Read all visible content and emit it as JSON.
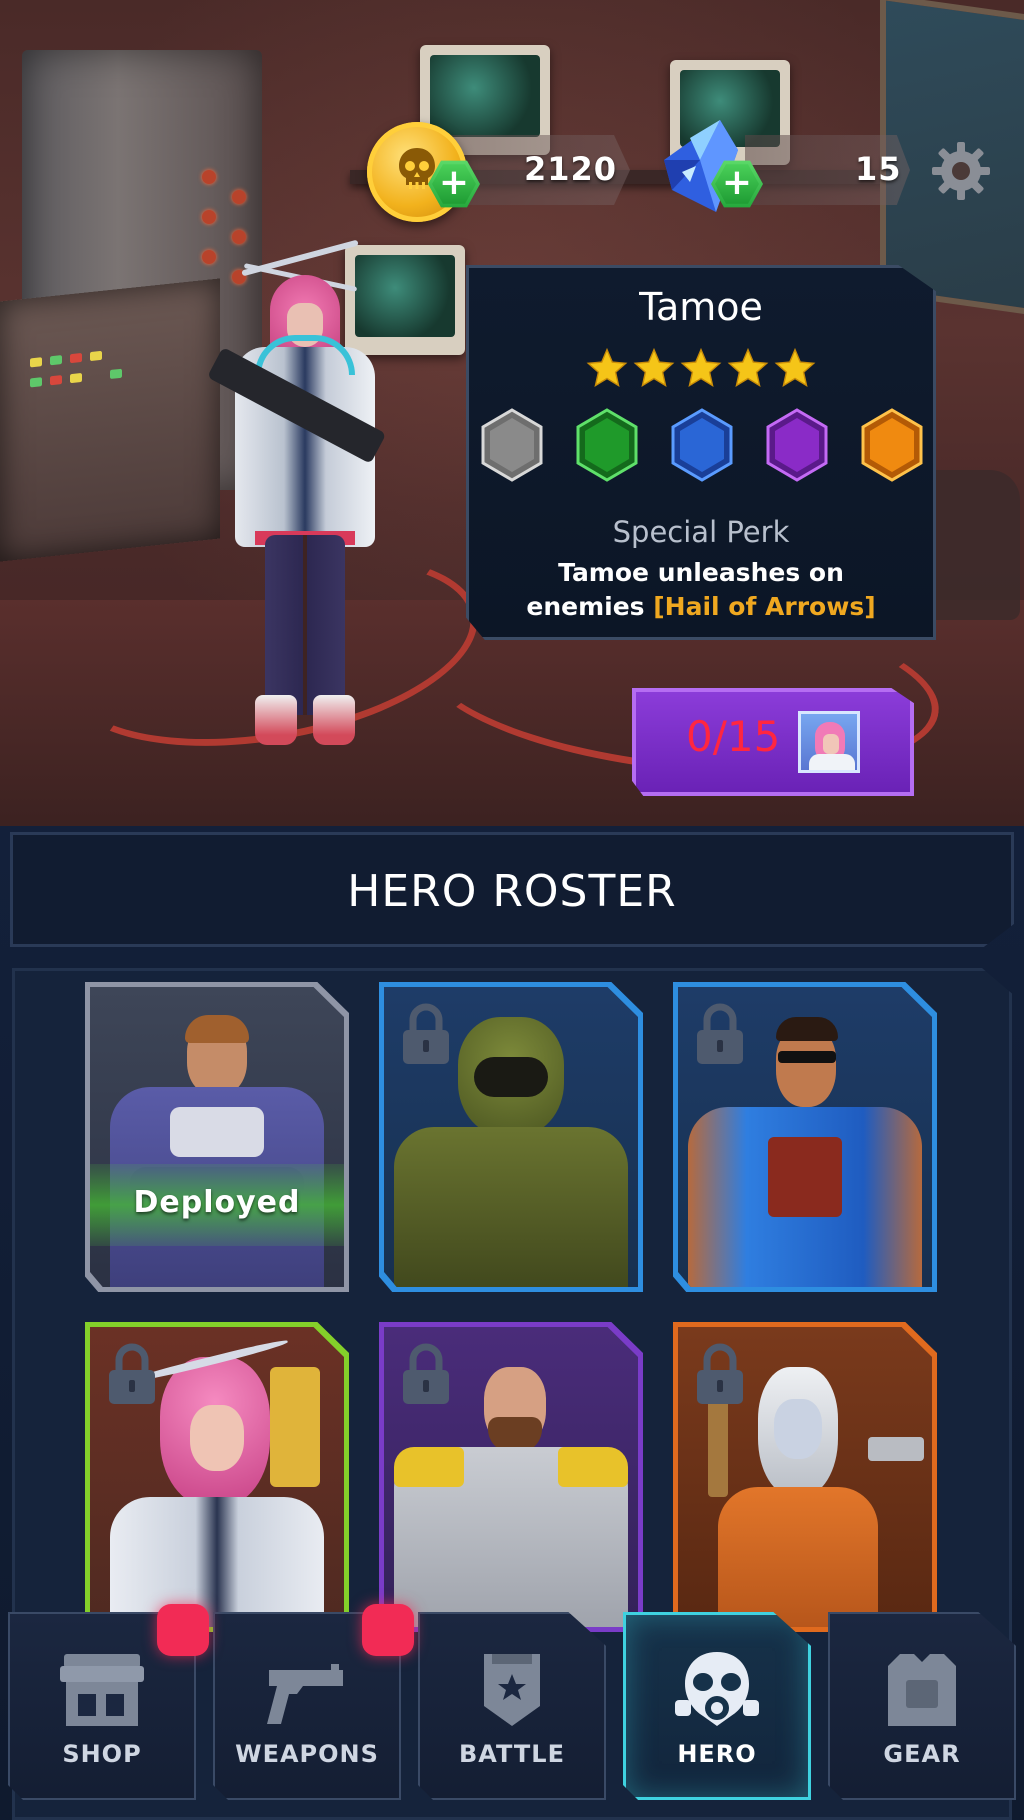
{
  "currency": {
    "gold": {
      "value": "2120",
      "icon": "skull-coin-icon",
      "add_icon": "plus-icon"
    },
    "gems": {
      "value": "15",
      "icon": "blue-crystal-icon",
      "add_icon": "plus-icon"
    },
    "settings_icon": "gear-icon"
  },
  "hero_card": {
    "name": "Tamoe",
    "stars": 5,
    "star_color": "#f5c518",
    "rank_colors": [
      "#8a8a8a",
      "#1f9a2a",
      "#2a66d6",
      "#8a2bc7",
      "#f08a10"
    ],
    "perk_title": "Special Perk",
    "perk_line1": "Tamoe unleashes on",
    "perk_line2_prefix": "enemies ",
    "perk_highlight": "[Hail of Arrows]",
    "highlight_color": "#f0a820"
  },
  "shards": {
    "text": "0/15",
    "color": "#ff2640"
  },
  "roster": {
    "title": "HERO ROSTER",
    "heroes": [
      {
        "rarity": "common",
        "frame_color": "#8f95a6",
        "locked": false,
        "status": "Deployed"
      },
      {
        "rarity": "rare",
        "frame_color": "#2e8ee0",
        "locked": true
      },
      {
        "rarity": "rare",
        "frame_color": "#2e8ee0",
        "locked": true
      },
      {
        "rarity": "uncommon",
        "frame_color": "#84d02a",
        "locked": true
      },
      {
        "rarity": "epic",
        "frame_color": "#7a3cc8",
        "locked": true
      },
      {
        "rarity": "legendary",
        "frame_color": "#e06a1e",
        "locked": true
      }
    ]
  },
  "nav": {
    "tabs": [
      {
        "label": "SHOP",
        "icon": "shop-icon",
        "notification": true
      },
      {
        "label": "WEAPONS",
        "icon": "pistol-icon",
        "notification": true
      },
      {
        "label": "BATTLE",
        "icon": "battle-badge-icon",
        "notification": false
      },
      {
        "label": "HERO",
        "icon": "gas-mask-icon",
        "notification": false,
        "active": true
      },
      {
        "label": "GEAR",
        "icon": "armor-vest-icon",
        "notification": false
      }
    ],
    "accent": "#3fd2e0",
    "notification_color": "#f22b55"
  }
}
